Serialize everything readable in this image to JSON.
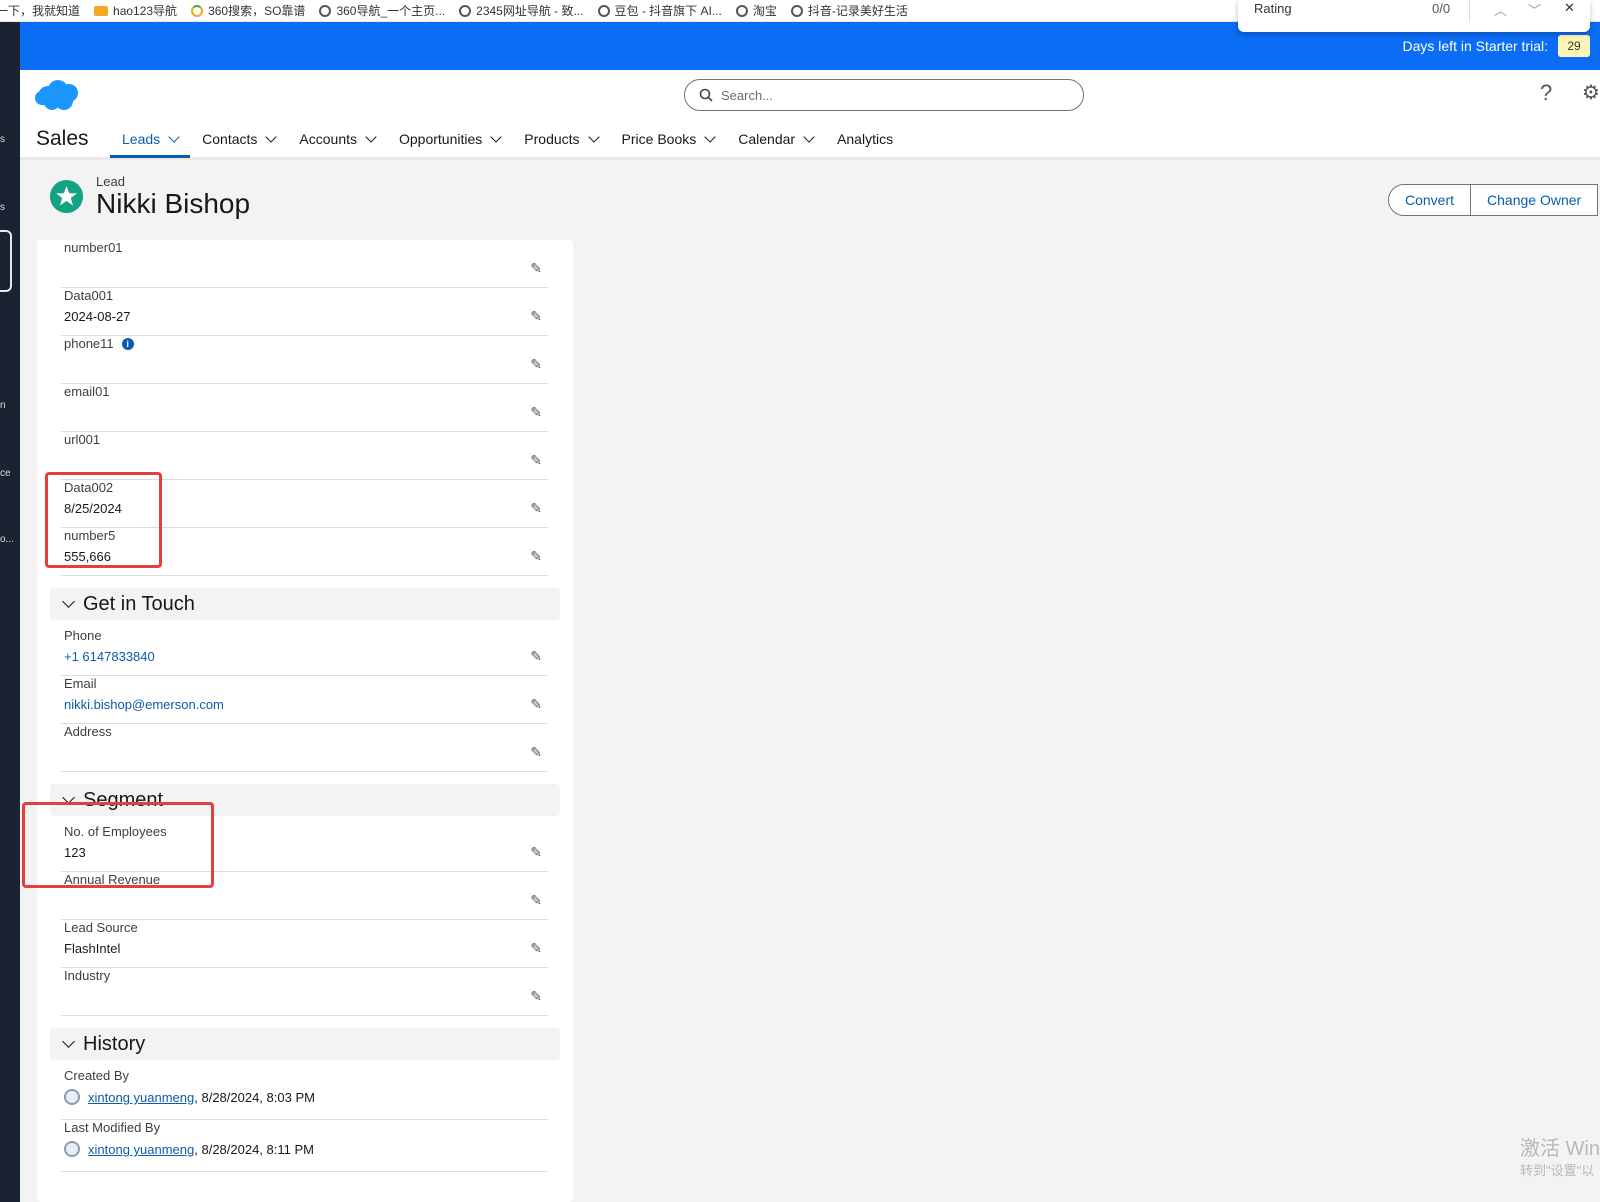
{
  "bookmarks": [
    "一下，我就知道",
    "hao123导航",
    "360搜索，SO靠谱",
    "360导航_一个主页...",
    "2345网址导航 - 致...",
    "豆包 - 抖音旗下 AI...",
    "淘宝",
    "抖音-记录美好生活"
  ],
  "findbar": {
    "query": "Rating",
    "count": "0/0",
    "up": "︿",
    "down": "﹀",
    "close": "✕"
  },
  "trial": {
    "text": "Days left in Starter trial:",
    "days": "29"
  },
  "search": {
    "placeholder": "Search..."
  },
  "header": {
    "app_name": "Sales",
    "help": "?",
    "gear": "⚙"
  },
  "nav": [
    "Leads",
    "Contacts",
    "Accounts",
    "Opportunities",
    "Products",
    "Price Books",
    "Calendar",
    "Analytics"
  ],
  "record": {
    "type": "Lead",
    "name": "Nikki Bishop"
  },
  "actions": {
    "convert": "Convert",
    "change_owner": "Change Owner"
  },
  "fields_top": [
    {
      "label": "number01",
      "value": ""
    },
    {
      "label": "Data001",
      "value": "2024-08-27"
    },
    {
      "label": "phone11",
      "value": ""
    },
    {
      "label": "email01",
      "value": ""
    },
    {
      "label": "url001",
      "value": ""
    },
    {
      "label": "Data002",
      "value": "8/25/2024"
    },
    {
      "label": "number5",
      "value": "555,666"
    }
  ],
  "sections": {
    "get_in_touch": "Get in Touch",
    "segment": "Segment",
    "history": "History"
  },
  "get_in_touch": [
    {
      "label": "Phone",
      "value": "+1 6147833840"
    },
    {
      "label": "Email",
      "value": "nikki.bishop@emerson.com"
    },
    {
      "label": "Address",
      "value": ""
    }
  ],
  "segment": [
    {
      "label": "No. of Employees",
      "value": "123"
    },
    {
      "label": "Annual Revenue",
      "value": ""
    },
    {
      "label": "Lead Source",
      "value": "FlashIntel"
    },
    {
      "label": "Industry",
      "value": ""
    }
  ],
  "history": [
    {
      "label": "Created By",
      "user": "xintong yuanmeng",
      "date": ", 8/28/2024, 8:03 PM"
    },
    {
      "label": "Last Modified By",
      "user": "xintong yuanmeng",
      "date": ", 8/28/2024, 8:11 PM"
    }
  ],
  "pencil": "✎",
  "info": "i",
  "watermark": {
    "line1": "激活 Win",
    "line2": "转到\"设置\"以"
  },
  "left_fragments": [
    "s",
    "s",
    "n",
    "ce",
    "o..."
  ]
}
